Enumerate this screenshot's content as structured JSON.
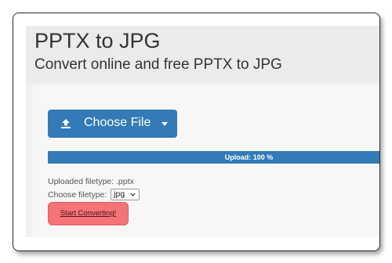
{
  "header": {
    "title": "PPTX to JPG",
    "subtitle": "Convert online and free PPTX to JPG"
  },
  "upload": {
    "choose_file_label": "Choose File",
    "icons": {
      "upload": "upload-icon",
      "dropdown": "chevron-down-icon"
    }
  },
  "progress": {
    "text": "Upload: 100 %",
    "percent": 100,
    "color": "#337ab7"
  },
  "file_info": {
    "uploaded_filetype": "Uploaded filetype: .pptx",
    "choose_filetype_label": "Choose filetype:",
    "selected_filetype": "jpg"
  },
  "convert": {
    "label": "Start Converting!",
    "color": "#f47377"
  },
  "colors": {
    "primary": "#337ab7",
    "danger": "#f47377",
    "header_bg": "#ebebeb",
    "panel_bg": "#f7f7f7"
  }
}
